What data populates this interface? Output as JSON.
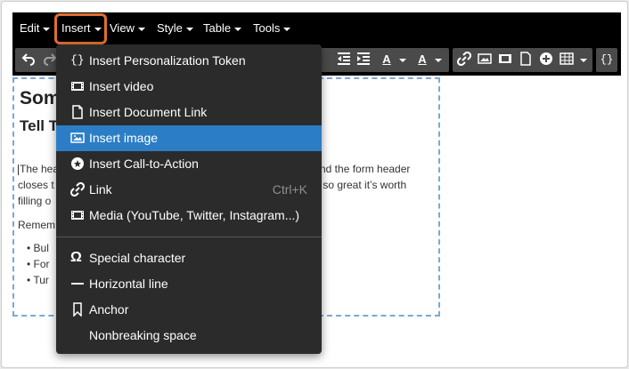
{
  "menubar": {
    "items": [
      "Edit",
      "Insert",
      "View",
      "Style",
      "Table",
      "Tools"
    ]
  },
  "editor": {
    "heading1": "Som",
    "heading2": "Tell T",
    "para_line1_left": "The hea",
    "para_line1_right": "nd the form header",
    "para_line2_left": "closes t",
    "para_line2_right": "s so great it’s worth",
    "para_line3_left": "filling o",
    "remember": "Remem",
    "bullets": [
      "Bul",
      "For",
      "Tur"
    ]
  },
  "insert_menu": {
    "items": [
      {
        "label": "Insert Personalization Token",
        "icon": "braces-icon"
      },
      {
        "label": "Insert video",
        "icon": "film-icon"
      },
      {
        "label": "Insert Document Link",
        "icon": "document-icon"
      },
      {
        "label": "Insert image",
        "icon": "image-icon",
        "selected": true
      },
      {
        "label": "Insert Call-to-Action",
        "icon": "cta-icon"
      },
      {
        "label": "Link",
        "icon": "link-icon",
        "shortcut": "Ctrl+K"
      },
      {
        "label": "Media (YouTube, Twitter, Instagram...)",
        "icon": "film-icon"
      },
      {
        "label": "Special character",
        "icon": "omega-icon"
      },
      {
        "label": "Horizontal line",
        "icon": "horizontal-line-icon"
      },
      {
        "label": "Anchor",
        "icon": "bookmark-icon"
      },
      {
        "label": "Nonbreaking space",
        "icon": ""
      }
    ]
  },
  "colors": {
    "menubar_bg": "#000000",
    "dropdown_bg": "#2b2b2b",
    "selected_bg": "#2b7ec6",
    "highlight_outline": "#e1702e",
    "editor_border": "#7aa9d6"
  }
}
